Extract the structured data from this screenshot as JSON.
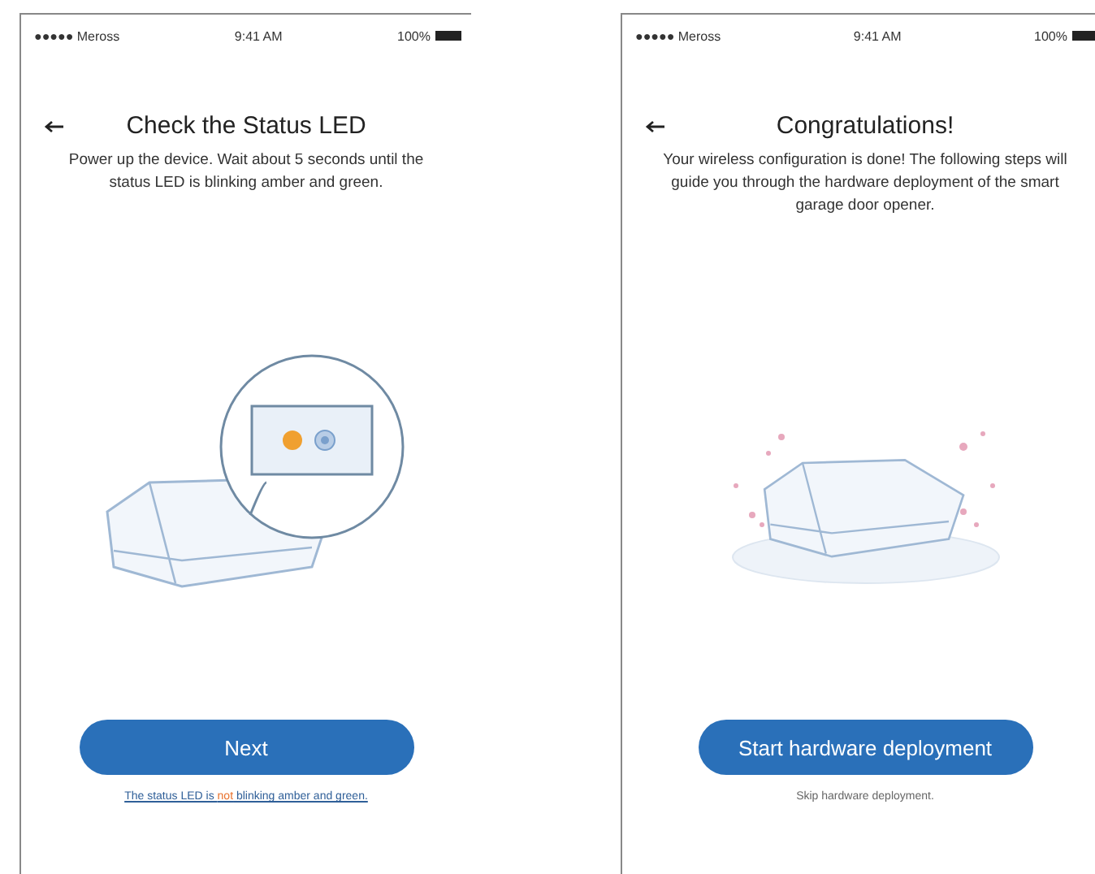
{
  "screens": [
    {
      "status_bar": {
        "carrier": "●●●●● Meross",
        "time": "9:41 AM",
        "battery": "100%"
      },
      "title": "Check the Status LED",
      "description": "Power up the device. Wait about 5 seconds until the status LED is blinking amber and green.",
      "illustration": {
        "kind": "led-check"
      },
      "primary_button": "Next",
      "secondary_link": {
        "text": "The status LED is **not** blinking amber and green.",
        "underlined": true
      }
    },
    {
      "status_bar": {
        "carrier": "●●●●● Meross",
        "time": "9:41 AM",
        "battery": "100%"
      },
      "title": "Congratulations!",
      "description": "Your wireless configuration is done! The following steps will guide you through the hardware deployment of the smart garage door opener.",
      "illustration": {
        "kind": "device-celebration"
      },
      "primary_button": "Start hardware deployment",
      "secondary_link": {
        "text": "Skip hardware deployment.",
        "underlined": false
      }
    }
  ]
}
